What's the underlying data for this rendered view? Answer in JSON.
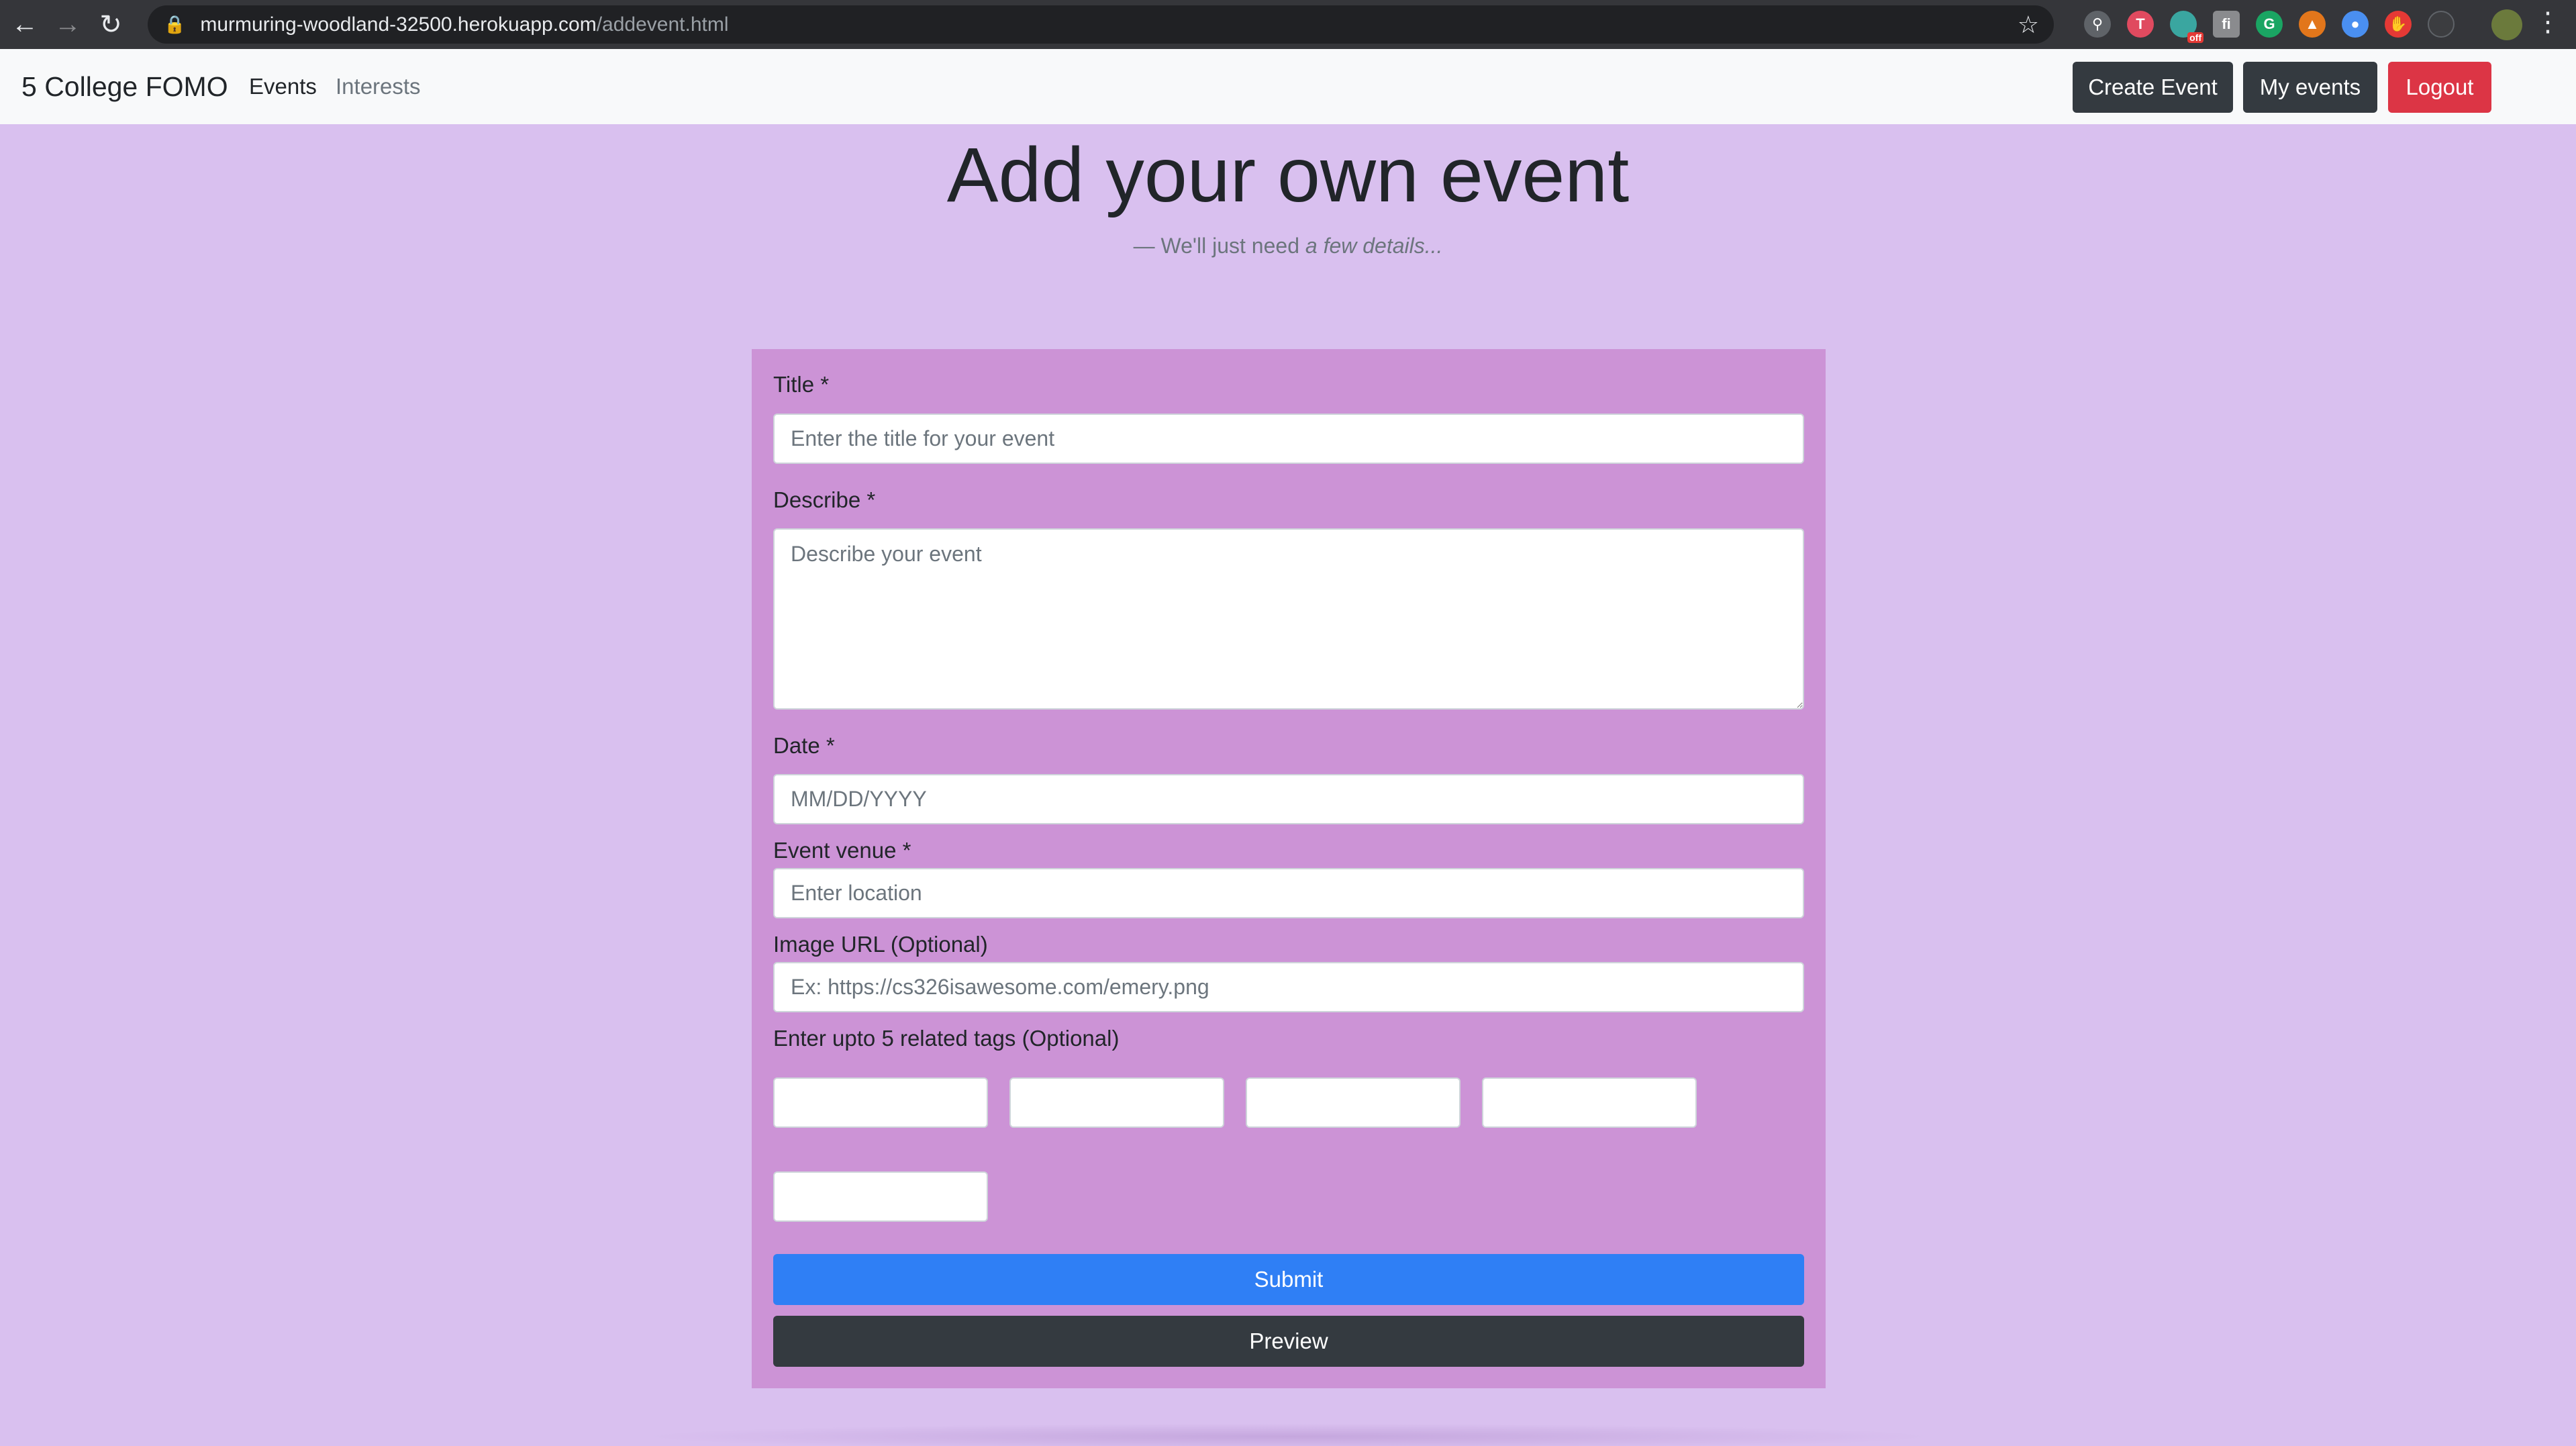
{
  "browser": {
    "url_host": "murmuring-woodland-32500.herokuapp.com",
    "url_path": "/addevent.html",
    "ext_badge": "off"
  },
  "navbar": {
    "brand": "5 College FOMO",
    "links": [
      "Events",
      "Interests"
    ],
    "buttons": {
      "create": "Create Event",
      "my_events": "My events",
      "logout": "Logout"
    }
  },
  "page": {
    "heading": "Add your own event",
    "subheading_prefix": "— We'll just need ",
    "subheading_em": "a few details..."
  },
  "form": {
    "title_label": "Title *",
    "title_placeholder": "Enter the title for your event",
    "describe_label": "Describe *",
    "describe_placeholder": "Describe your event",
    "date_label": "Date *",
    "date_placeholder": "MM/DD/YYYY",
    "venue_label": "Event venue *",
    "venue_placeholder": "Enter location",
    "image_label": "Image URL (Optional)",
    "image_placeholder": "Ex: https://cs326isawesome.com/emery.png",
    "tags_label": "Enter upto 5 related tags (Optional)",
    "submit": "Submit",
    "preview": "Preview"
  },
  "colors": {
    "page_bg": "#d9c0ef",
    "form_bg": "#cc93d6",
    "primary": "#2f7ff5",
    "dark": "#343a40",
    "danger": "#dc3545"
  }
}
